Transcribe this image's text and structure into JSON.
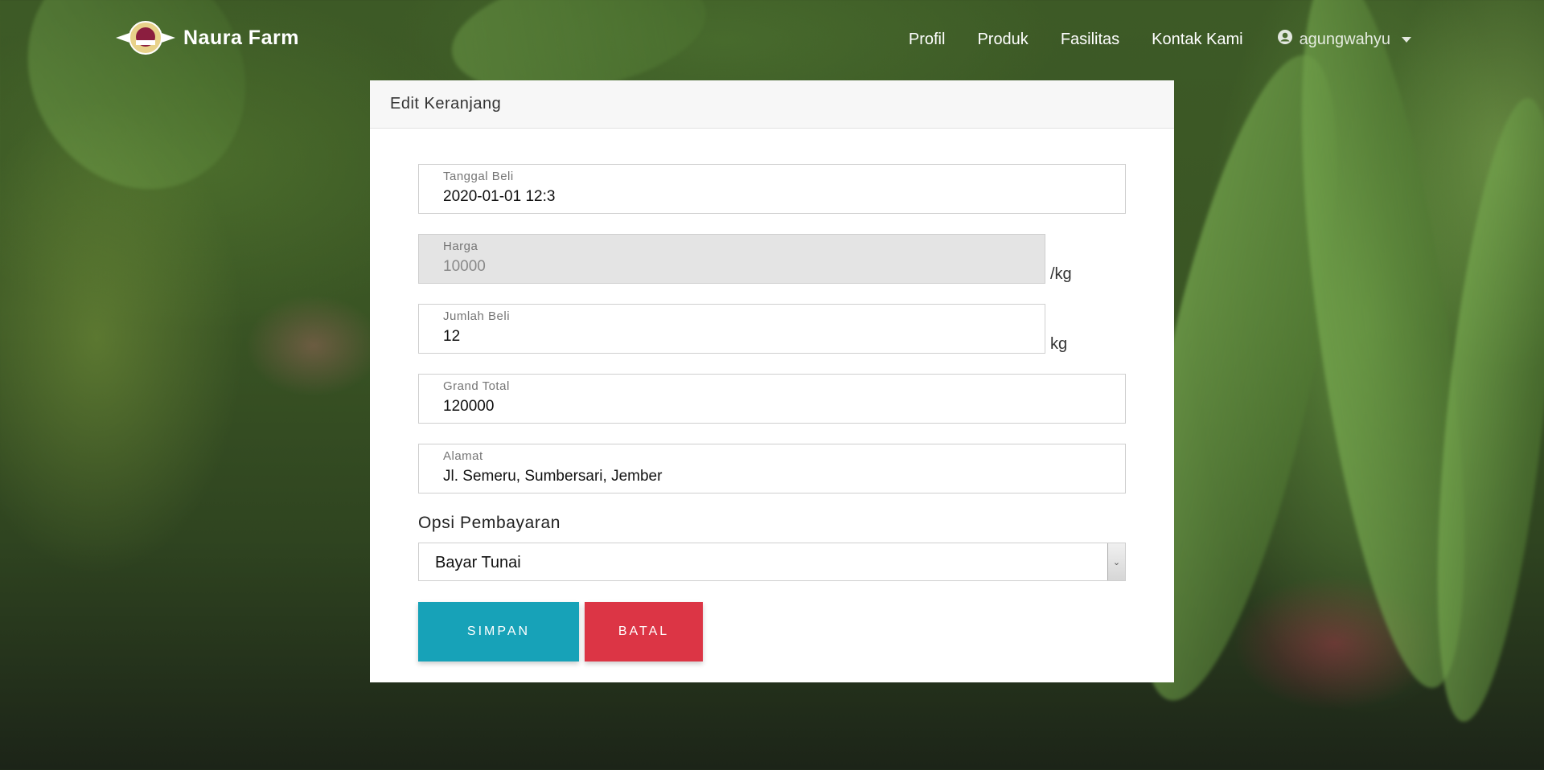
{
  "brand": {
    "name": "Naura Farm",
    "logo_icon": "farm-logo-icon"
  },
  "nav": {
    "links": [
      "Profil",
      "Produk",
      "Fasilitas",
      "Kontak Kami"
    ],
    "user": "agungwahyu"
  },
  "card": {
    "title": "Edit Keranjang",
    "fields": {
      "tanggal": {
        "label": "Tanggal Beli",
        "value": "2020-01-01 12:3"
      },
      "harga": {
        "label": "Harga",
        "value": "10000",
        "unit": "/kg"
      },
      "jumlah": {
        "label": "Jumlah Beli",
        "value": "12",
        "unit": "kg"
      },
      "total": {
        "label": "Grand Total",
        "value": "120000"
      },
      "alamat": {
        "label": "Alamat",
        "value": "Jl. Semeru, Sumbersari, Jember"
      }
    },
    "payment": {
      "label": "Opsi Pembayaran",
      "selected": "Bayar Tunai"
    },
    "buttons": {
      "save": "SIMPAN",
      "cancel": "BATAL"
    }
  },
  "colors": {
    "save": "#17a2b8",
    "cancel": "#dc3545"
  }
}
